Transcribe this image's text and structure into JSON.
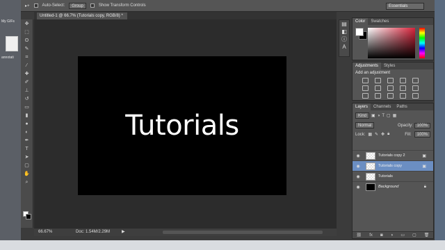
{
  "desktop": {
    "label_top": "My GIFs",
    "label_bottom": "annotati"
  },
  "options_bar": {
    "auto_select_label": "Auto-Select:",
    "auto_select_value": "Group",
    "show_transform_label": "Show Transform Controls",
    "workspace": "Essentials"
  },
  "document": {
    "tab_title": "Untitled-1 @ 66.7% (Tutorials copy, RGB/8) *",
    "canvas_text": "Tutorials"
  },
  "status": {
    "zoom": "66.67%",
    "doc_size": "Doc: 1.54M/2.29M"
  },
  "color_panel": {
    "tabs": [
      "Color",
      "Swatches"
    ]
  },
  "adjustments_panel": {
    "tabs": [
      "Adjustments",
      "Styles"
    ],
    "title": "Add an adjustment"
  },
  "layers_panel": {
    "tabs": [
      "Layers",
      "Channels",
      "Paths"
    ],
    "filter": "Kind",
    "blend_mode": "Normal",
    "opacity_label": "Opacity:",
    "opacity_value": "100%",
    "lock_label": "Lock:",
    "fill_label": "Fill:",
    "fill_value": "100%",
    "layers": [
      {
        "name": "Tutorials copy 2",
        "selected": false
      },
      {
        "name": "Tutorials copy",
        "selected": true
      },
      {
        "name": "Tutorials",
        "selected": false
      },
      {
        "name": "Background",
        "selected": false
      }
    ]
  },
  "colors": {
    "accent_selected_layer": "#6b8ec2",
    "canvas_bg": "#000000",
    "workspace_bg": "#2c2c2c"
  }
}
